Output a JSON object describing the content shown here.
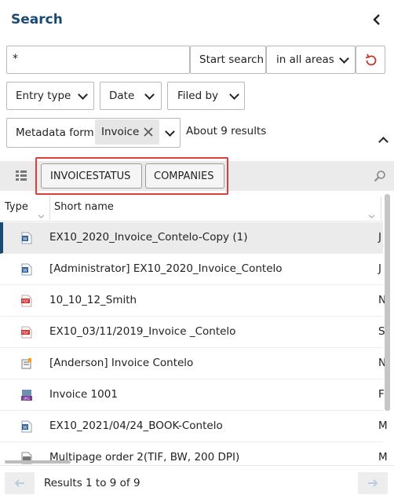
{
  "header": {
    "title": "Search",
    "collapse_icon": "chevron-left-icon"
  },
  "search": {
    "value": "*",
    "start_label": "Start search",
    "area_selected": "in all areas",
    "reset_icon": "reset-icon"
  },
  "filters": [
    {
      "label": "Entry type"
    },
    {
      "label": "Date"
    },
    {
      "label": "Filed by"
    }
  ],
  "metadata": {
    "label": "Metadata form",
    "chip_label": "Invoice",
    "result_count": "About 9 results"
  },
  "facets": [
    {
      "label": "INVOICESTATUS"
    },
    {
      "label": "COMPANIES"
    }
  ],
  "columns": {
    "type": "Type",
    "short_name": "Short name"
  },
  "rows": [
    {
      "icon": "word-doc-icon",
      "name": "EX10_2020_Invoice_Contelo-Copy (1)",
      "trail": "J",
      "selected": true
    },
    {
      "icon": "word-doc-icon",
      "name": "[Administrator] EX10_2020_Invoice_Contelo",
      "trail": "J"
    },
    {
      "icon": "pdf-icon",
      "name": "10_10_12_Smith",
      "trail": "N"
    },
    {
      "icon": "pdf-icon",
      "name": "EX10_03/11/2019_Invoice _Contelo",
      "trail": "S"
    },
    {
      "icon": "folder-doc-icon",
      "name": "[Anderson] Invoice Contelo",
      "trail": "N"
    },
    {
      "icon": "jpg-icon",
      "name": "Invoice 1001",
      "trail": "F"
    },
    {
      "icon": "word-doc-icon",
      "name": "EX10_2021/04/24_BOOK-Contelo",
      "trail": "M"
    },
    {
      "icon": "tif-icon",
      "name": "Multipage order 2(TIF, BW, 200 DPI)",
      "trail": "M"
    }
  ],
  "footer": {
    "results_label": "Results 1 to 9 of 9"
  },
  "colors": {
    "brand": "#1a4a72",
    "highlight": "#e03c3c"
  }
}
